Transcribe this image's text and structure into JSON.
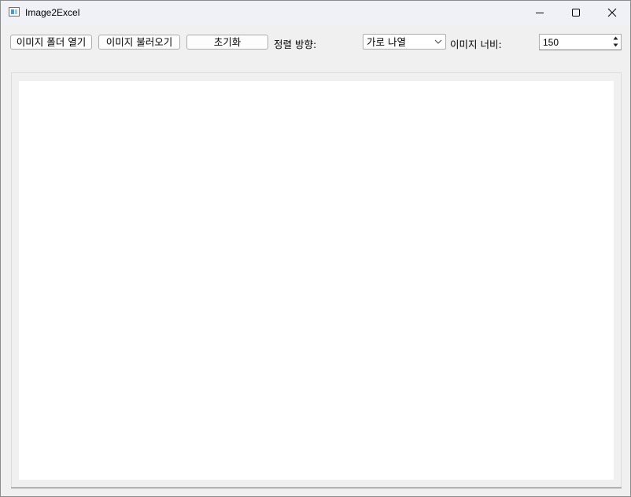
{
  "window": {
    "title": "Image2Excel",
    "icon": "app-window-icon",
    "controls": {
      "minimize_icon": "minimize-icon",
      "maximize_icon": "maximize-icon",
      "close_icon": "close-icon"
    }
  },
  "toolbar": {
    "open_folder_label": "이미지 폴더 열기",
    "load_images_label": "이미지 불러오기",
    "reset_label": "초기화",
    "sort_direction_label": "정렬 방향:",
    "sort_direction_value": "가로 나열",
    "image_width_label": "이미지 너비:",
    "image_width_value": "150"
  },
  "colors": {
    "titlebar_bg": "#eff1f7",
    "window_bg": "#f0f0f0",
    "canvas_bg": "#ffffff"
  }
}
